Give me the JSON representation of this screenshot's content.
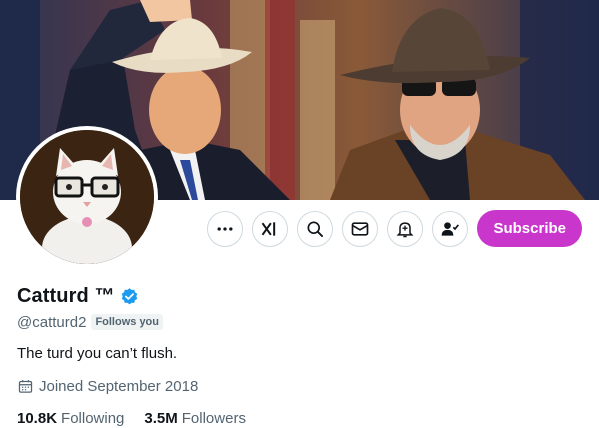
{
  "profile": {
    "display_name": "Catturd ™",
    "handle": "@catturd2",
    "follows_you": "Follows you",
    "bio": "The turd you can’t flush.",
    "joined": "Joined September 2018",
    "verified": true
  },
  "stats": {
    "following_count": "10.8K",
    "following_label": "Following",
    "followers_count": "3.5M",
    "followers_label": "Followers"
  },
  "actions": {
    "subscribe_label": "Subscribe",
    "icons": [
      "more-icon",
      "grok-icon",
      "search-icon",
      "message-icon",
      "notifications-icon",
      "following-icon"
    ]
  },
  "colors": {
    "subscribe_bg": "#c936cc",
    "verified": "#1d9bf0",
    "secondary_text": "#536471",
    "border": "#cfd9de"
  }
}
